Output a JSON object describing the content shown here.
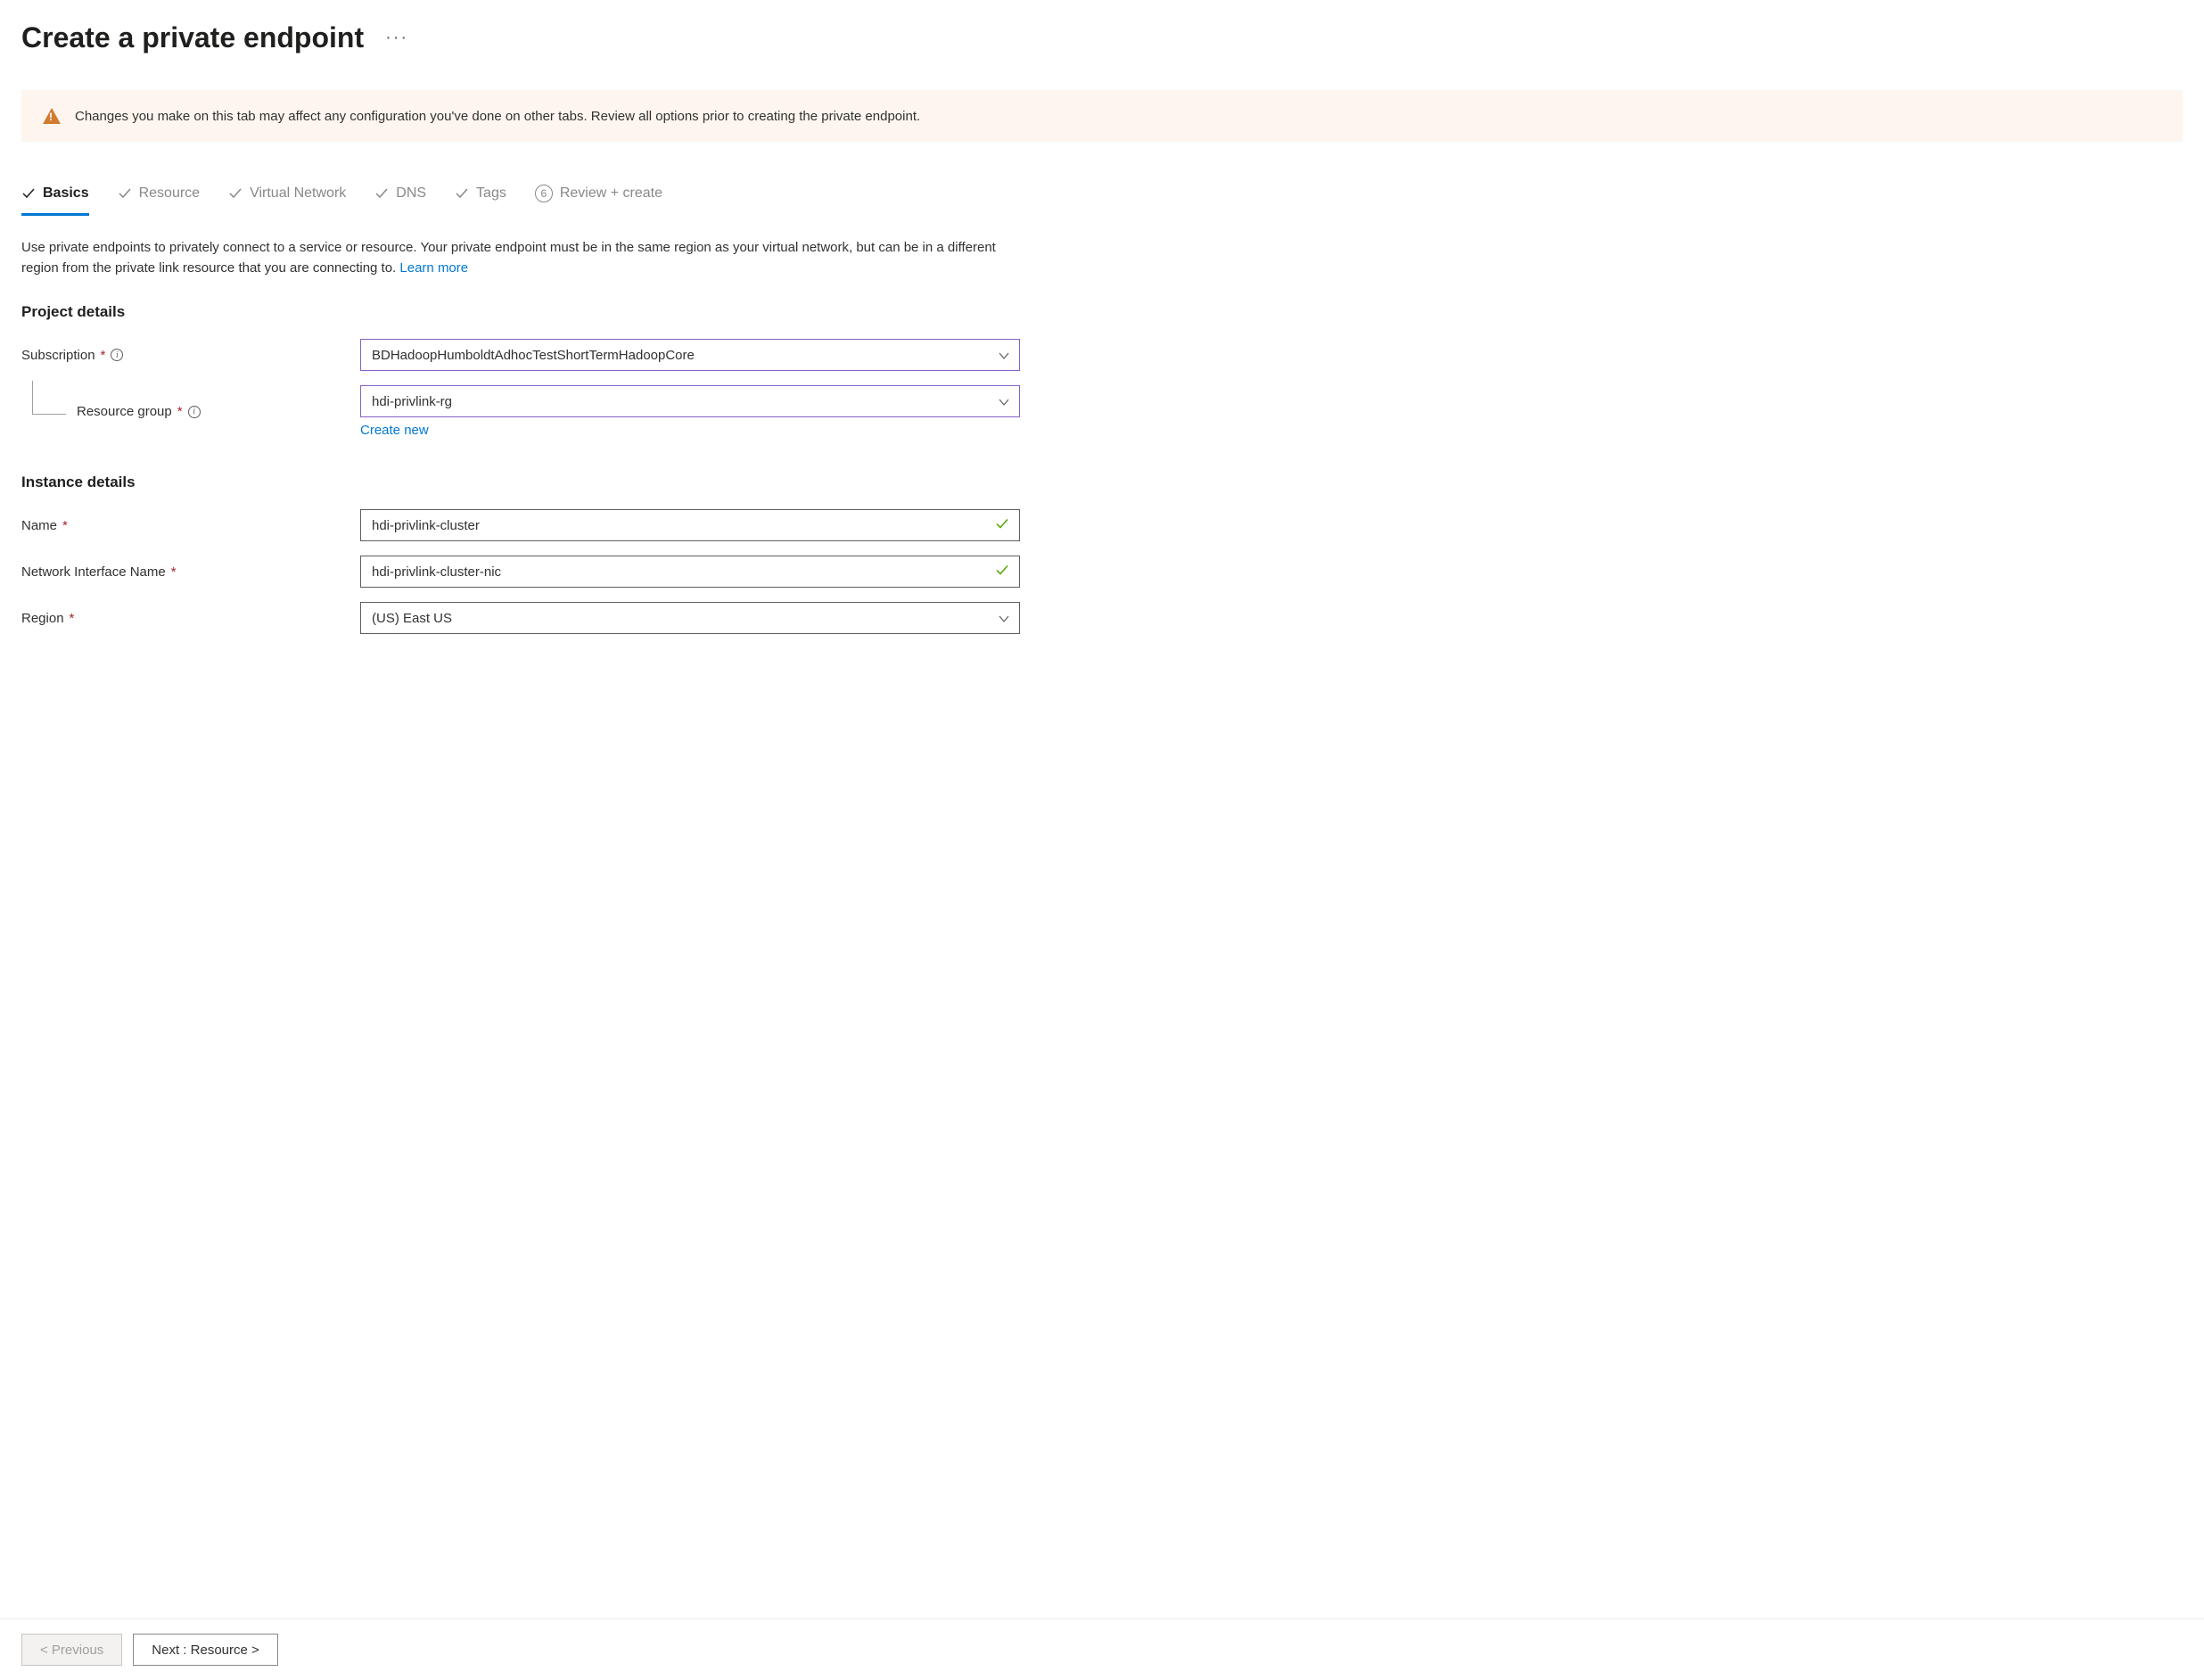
{
  "header": {
    "title": "Create a private endpoint"
  },
  "warning": {
    "text": "Changes you make on this tab may affect any configuration you've done on other tabs. Review all options prior to creating the private endpoint."
  },
  "tabs": {
    "basics": "Basics",
    "resource": "Resource",
    "vnet": "Virtual Network",
    "dns": "DNS",
    "tags": "Tags",
    "review_number": "6",
    "review": "Review + create"
  },
  "description": {
    "text": "Use private endpoints to privately connect to a service or resource. Your private endpoint must be in the same region as your virtual network, but can be in a different region from the private link resource that you are connecting to.  ",
    "learn_more": "Learn more"
  },
  "sections": {
    "project_details": "Project details",
    "instance_details": "Instance details"
  },
  "form": {
    "subscription_label": "Subscription",
    "subscription_value": "BDHadoopHumboldtAdhocTestShortTermHadoopCore",
    "resource_group_label": "Resource group",
    "resource_group_value": "hdi-privlink-rg",
    "create_new": "Create new",
    "name_label": "Name",
    "name_value": "hdi-privlink-cluster",
    "nic_label": "Network Interface Name",
    "nic_value": "hdi-privlink-cluster-nic",
    "region_label": "Region",
    "region_value": "(US) East US"
  },
  "footer": {
    "previous": "< Previous",
    "next": "Next : Resource >"
  }
}
